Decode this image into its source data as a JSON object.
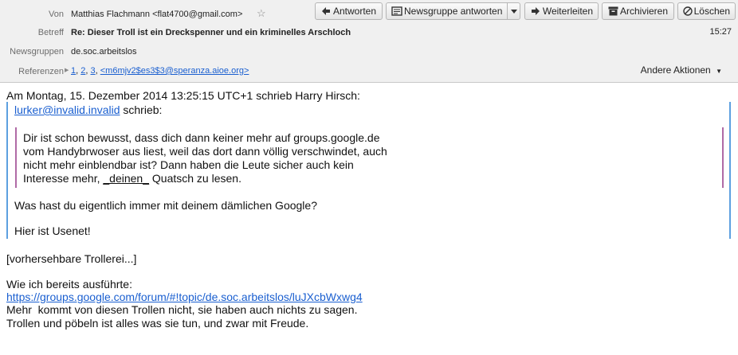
{
  "header": {
    "from_label": "Von",
    "from_value": "Matthias Flachmann <flat4700@gmail.com>",
    "subject_label": "Betreff",
    "subject_value": "Re: Dieser Troll ist ein Dreckspenner und ein kriminelles Arschloch",
    "time": "15:27",
    "newsgroups_label": "Newsgruppen",
    "newsgroups_value": "de.soc.arbeitslos",
    "references_label": "Referenzen",
    "references": [
      "1",
      "2",
      "3",
      "<m6mjv2$es3$3@speranza.aioe.org>"
    ],
    "other_actions": "Andere Aktionen"
  },
  "toolbar": {
    "reply": "Antworten",
    "reply_newsgroup": "Newsgruppe antworten",
    "forward": "Weiterleiten",
    "archive": "Archivieren",
    "delete": "Löschen"
  },
  "message": {
    "intro": "Am Montag, 15. Dezember 2014 13:25:15 UTC+1 schrieb Harry Hirsch:",
    "quote_author_link": "lurker@invalid.invalid",
    "quote_author_suffix": " schrieb:",
    "inner_quote_lines": [
      "Dir ist schon bewusst, dass dich dann keiner mehr auf groups.google.de",
      "vom Handybrwoser aus liest, weil das dort dann völlig verschwindet, auch",
      "nicht mehr einblendbar ist? Dann haben die Leute sicher auch kein",
      "Interesse mehr, "
    ],
    "inner_quote_emph": "_deinen_",
    "inner_quote_tail": " Quatsch zu lesen.",
    "quote_line_1": "Was hast du eigentlich immer mit deinem dämlichen Google?",
    "quote_line_2": "Hier ist Usenet!",
    "line_troll": "[vorhersehbare Trollerei...]",
    "line_explained": "Wie ich bereits ausführte:",
    "link": "https://groups.google.com/forum/#!topic/de.soc.arbeitslos/luJXcbWxwg4",
    "line_more": "Mehr  kommt von diesen Trollen nicht, sie haben auch nichts zu sagen.",
    "line_last": "Trollen und pöbeln ist alles was sie tun, und zwar mit Freude."
  }
}
